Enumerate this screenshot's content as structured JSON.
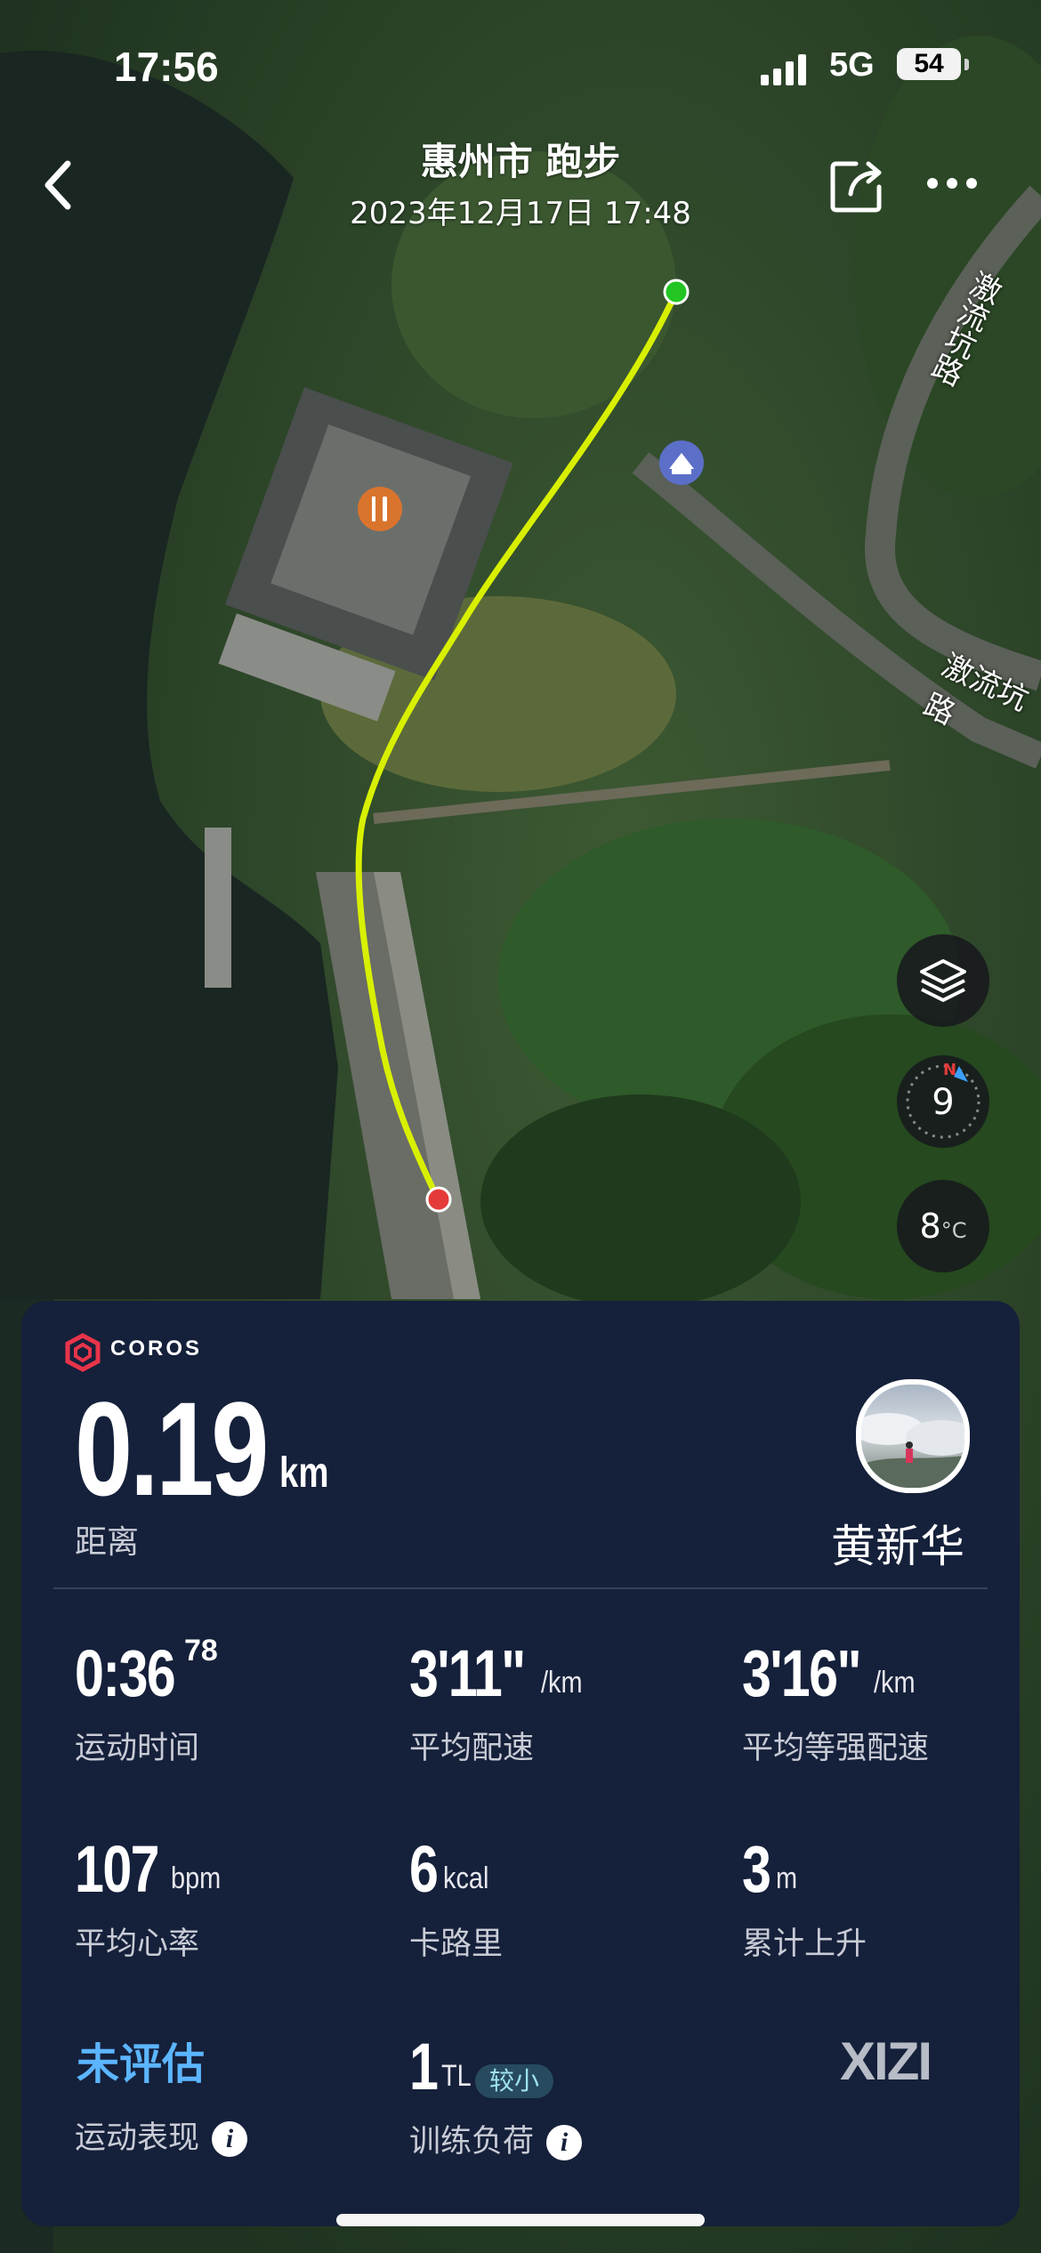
{
  "status_bar": {
    "time": "17:56",
    "network": "5G",
    "battery": "54"
  },
  "header": {
    "title": "惠州市 跑步",
    "subtitle": "2023年12月17日 17:48"
  },
  "map": {
    "road_labels": [
      "激流坑路",
      "激流坑路"
    ],
    "route_color": "#d8f000",
    "start_color": "#22c522",
    "end_color": "#e53a3a",
    "compass_value": "9",
    "compass_north": "N",
    "temperature": "8",
    "temperature_unit": "°C"
  },
  "card": {
    "brand": "COROS",
    "distance": {
      "value": "0.19",
      "unit": "km",
      "label": "距离"
    },
    "athlete_name": "黄新华",
    "stats": [
      {
        "value": "0:36",
        "sup": "78",
        "unit": "",
        "label": "运动时间"
      },
      {
        "value": "3'11\"",
        "sup": "",
        "unit": "/km",
        "label": "平均配速"
      },
      {
        "value": "3'16\"",
        "sup": "",
        "unit": "/km",
        "label": "平均等强配速"
      },
      {
        "value": "107",
        "sup": "",
        "unit": "bpm",
        "label": "平均心率"
      },
      {
        "value": "6",
        "sup": "",
        "unit": "kcal",
        "label": "卡路里"
      },
      {
        "value": "3",
        "sup": "",
        "unit": "m",
        "label": "累计上升"
      }
    ],
    "performance": {
      "value": "未评估",
      "label": "运动表现"
    },
    "training_load": {
      "value": "1",
      "unit": "TL",
      "tag": "较小",
      "label": "训练负荷"
    },
    "info_glyph": "i",
    "watermark": "XIZI"
  },
  "colors": {
    "card_bg": "#15203a",
    "accent_blue": "#5cb5ff",
    "brand_red": "#e8344a"
  }
}
